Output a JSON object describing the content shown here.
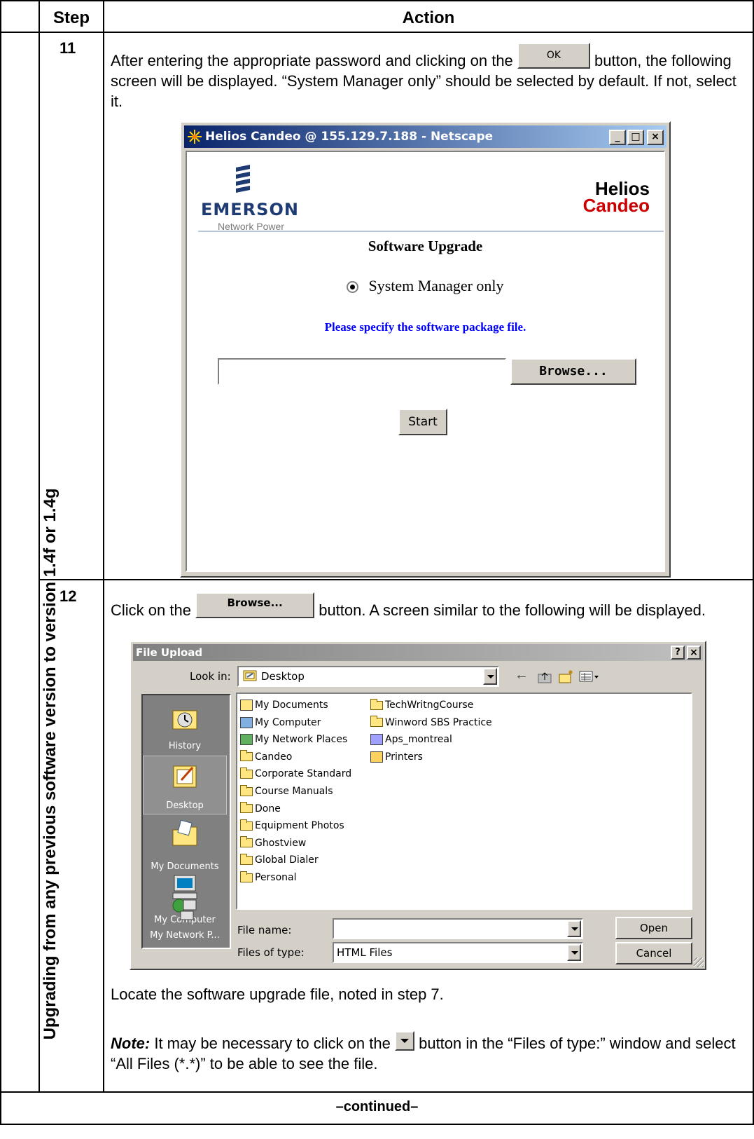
{
  "table": {
    "header_step": "Step",
    "header_action": "Action",
    "side_label": "Upgrading from any previous software version to version 1.4f or 1.4g",
    "footer": "–continued–"
  },
  "step11": {
    "number": "11",
    "text_before_button": "After entering the appropriate password and clicking on the",
    "button_label": "OK",
    "text_after_button": "button,",
    "text_rest": "the following screen will be displayed. “System Manager only” should be selected by default. If not, select it."
  },
  "netscape": {
    "title": "Helios Candeo @ 155.129.7.188 - Netscape",
    "logo_company": "EMERSON",
    "logo_sub": "Network Power",
    "product_line1": "Helios",
    "product_line2": "Candeo",
    "heading": "Software Upgrade",
    "radio_label": "System Manager only",
    "instruction": "Please specify the software package file.",
    "file_value": "",
    "browse_label": "Browse...",
    "start_label": "Start",
    "colors": {
      "titlebar": "#0a246a",
      "instruction": "#0000ff",
      "product_red": "#cc0000"
    }
  },
  "step12": {
    "number": "12",
    "text_before_button": "Click on the",
    "button_label": "Browse...",
    "text_after_button": "button. A screen similar to the following will be",
    "text_rest": "displayed.",
    "locate_text": "Locate the software upgrade file, noted in step 7.",
    "note_label": "Note:",
    "note_before_button": "It may be necessary to click on the",
    "note_after_button": "button in the “Files of type:”",
    "note_rest": "window and select “All Files (*.*)” to be able to see the file."
  },
  "dialog": {
    "title": "File Upload",
    "help_glyph": "?",
    "close_glyph": "×",
    "look_in_label": "Look in:",
    "look_in_value": "Desktop",
    "places": [
      {
        "label": "History",
        "icon": "history-icon"
      },
      {
        "label": "Desktop",
        "icon": "desktop-icon"
      },
      {
        "label": "My Documents",
        "icon": "my-documents-icon"
      },
      {
        "label": "My Computer",
        "icon": "my-computer-icon"
      },
      {
        "label": "My Network P...",
        "icon": "my-network-places-icon"
      }
    ],
    "files_col1": [
      "My Documents",
      "My Computer",
      "My Network Places",
      "Candeo",
      "Corporate Standard",
      "Course Manuals",
      "Done",
      "Equipment Photos",
      "Ghostview",
      "Global Dialer",
      "Personal"
    ],
    "files_col2": [
      "TechWritngCourse",
      "Winword SBS Practice",
      "Aps_montreal",
      "Printers"
    ],
    "file_name_label": "File name:",
    "file_name_value": "",
    "files_of_type_label": "Files of type:",
    "files_of_type_value": "HTML Files",
    "open_label": "Open",
    "cancel_label": "Cancel"
  }
}
